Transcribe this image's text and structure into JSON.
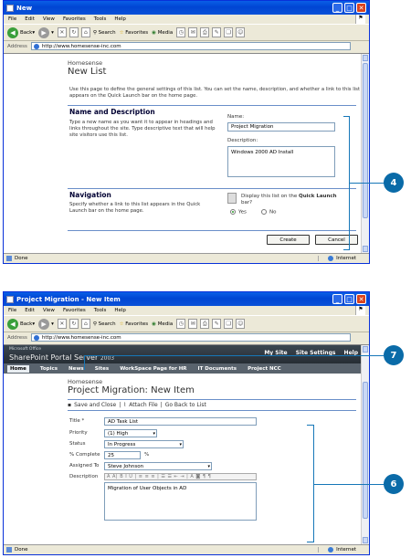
{
  "window1": {
    "title": "New",
    "menu": [
      "File",
      "Edit",
      "View",
      "Favorites",
      "Tools",
      "Help"
    ],
    "toolbar": {
      "back": "Back",
      "search": "Search",
      "favorites": "Favorites",
      "media": "Media"
    },
    "address_label": "Address",
    "address": "http://www.homesense-inc.com",
    "site_name": "Homesense",
    "page_title": "New List",
    "description": "Use this page to define the general settings of this list. You can set the name, description, and whether a link to this list appears on the Quick Launch bar on the home page.",
    "name_section": {
      "heading": "Name and Description",
      "text": "Type a new name as you want it to appear in headings and links throughout the site. Type descriptive text that will help site visitors use this list.",
      "name_label": "Name:",
      "name_value": "Project Migration",
      "desc_label": "Description:",
      "desc_value": "Windows 2000 AD Install"
    },
    "nav_section": {
      "heading": "Navigation",
      "text": "Specify whether a link to this list appears in the Quick Launch bar on the home page.",
      "question_pre": "Display this list on the ",
      "question_bold": "Quick Launch",
      "question_post": "bar?",
      "yes": "Yes",
      "no": "No",
      "selected": "Yes"
    },
    "create_label": "Create",
    "cancel_label": "Cancel",
    "status": "Done",
    "zone": "Internet"
  },
  "window2": {
    "title": "Project Migration - New Item",
    "menu": [
      "File",
      "Edit",
      "View",
      "Favorites",
      "Tools",
      "Help"
    ],
    "toolbar": {
      "back": "Back",
      "search": "Search",
      "favorites": "Favorites",
      "media": "Media"
    },
    "address_label": "Address",
    "address": "http://www.homesense-inc.com",
    "brand_small": "Microsoft Office",
    "brand_main": "SharePoint Portal Server",
    "brand_year": "2003",
    "top_links": [
      "My Site",
      "Site Settings",
      "Help"
    ],
    "nav": [
      "Home",
      "Topics",
      "News",
      "Sites",
      "WorkSpace Page for HR",
      "IT Documents",
      "Project NCC"
    ],
    "site_name": "Homesense",
    "page_title_pre": "Project Migration",
    "page_title_post": ": New Item",
    "list_toolbar": [
      "Save and Close",
      "Attach File",
      "Go Back to List"
    ],
    "fields": {
      "title_label": "Title *",
      "title_value": "AD Task List",
      "priority_label": "Priority",
      "priority_value": "(1) High",
      "status_label": "Status",
      "status_value": "In Progress",
      "complete_label": "% Complete",
      "complete_value": "25",
      "complete_unit": "%",
      "assigned_label": "Assigned To",
      "assigned_value": "Steve Johnson",
      "description_label": "Description",
      "description_value": "Migration of User Objects in AD"
    },
    "status": "Done",
    "zone": "Internet"
  },
  "callouts": [
    "4",
    "7",
    "6"
  ]
}
